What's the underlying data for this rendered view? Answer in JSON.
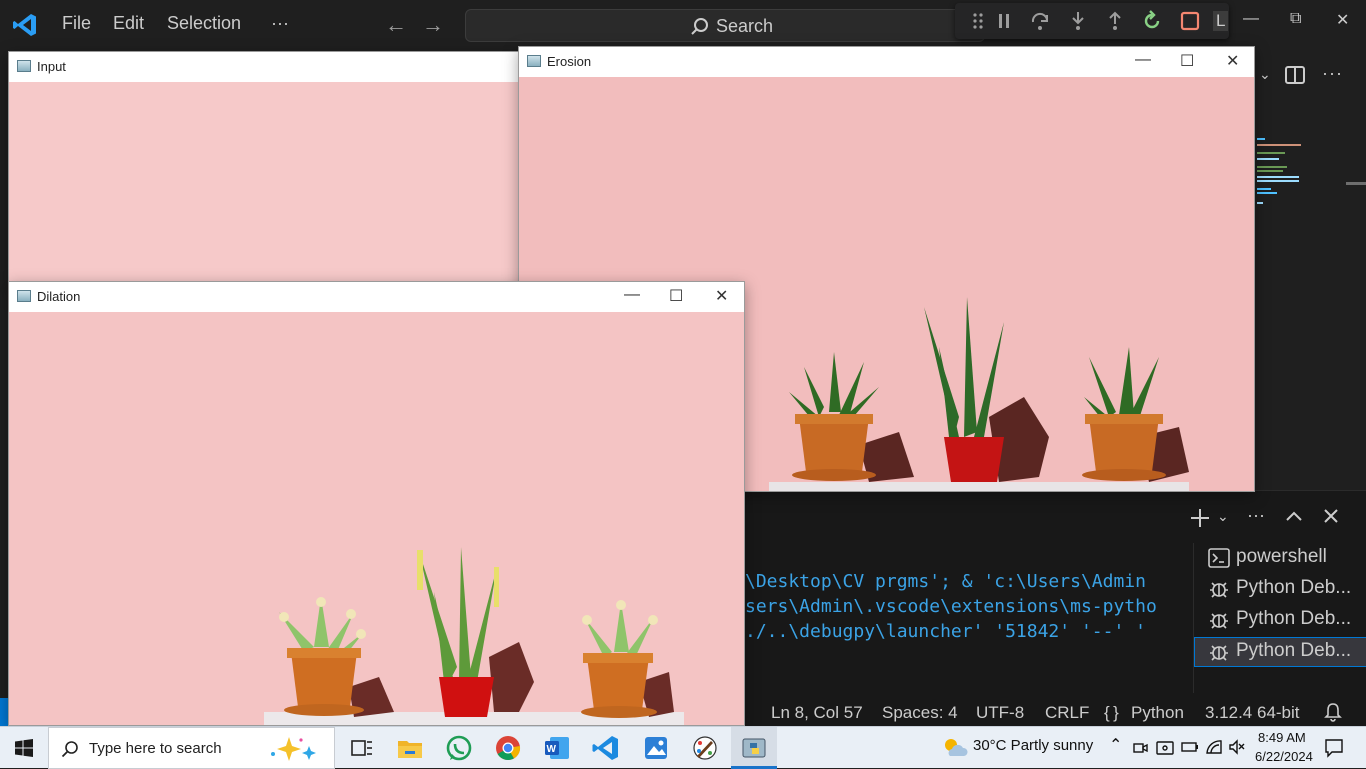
{
  "vscode": {
    "menu": [
      "File",
      "Edit",
      "Selection",
      "···"
    ],
    "search_label": "Search",
    "debug_overflow_label": "L",
    "terminal_lines": [
      "\\Desktop\\CV prgms'; & 'c:\\Users\\Admin",
      "sers\\Admin\\.vscode\\extensions\\ms-pytho",
      "./..\\debugpy\\launcher' '51842' '--' '"
    ],
    "terminal_list": [
      {
        "label": "powershell",
        "icon": "terminal-icon",
        "active": false
      },
      {
        "label": "Python Deb...",
        "icon": "debug-icon",
        "active": false
      },
      {
        "label": "Python Deb...",
        "icon": "debug-icon",
        "active": false
      },
      {
        "label": "Python Deb...",
        "icon": "debug-icon",
        "active": true
      }
    ],
    "status": {
      "position": "Ln 8, Col 57",
      "spaces": "Spaces: 4",
      "encoding": "UTF-8",
      "eol": "CRLF",
      "language": "Python",
      "interpreter": "3.12.4 64-bit"
    },
    "accent": "#0078d4"
  },
  "windows": {
    "input": {
      "title": "Input"
    },
    "erosion": {
      "title": "Erosion"
    },
    "dilation": {
      "title": "Dilation"
    }
  },
  "taskbar": {
    "search_placeholder": "Type here to search",
    "weather": "30°C  Partly sunny",
    "time": "8:49 AM",
    "date": "6/22/2024",
    "apps": [
      "task-view-icon",
      "file-explorer-icon",
      "whatsapp-icon",
      "chrome-icon",
      "word-icon",
      "vscode-icon",
      "photos-icon",
      "paint-icon",
      "python-icon"
    ]
  }
}
